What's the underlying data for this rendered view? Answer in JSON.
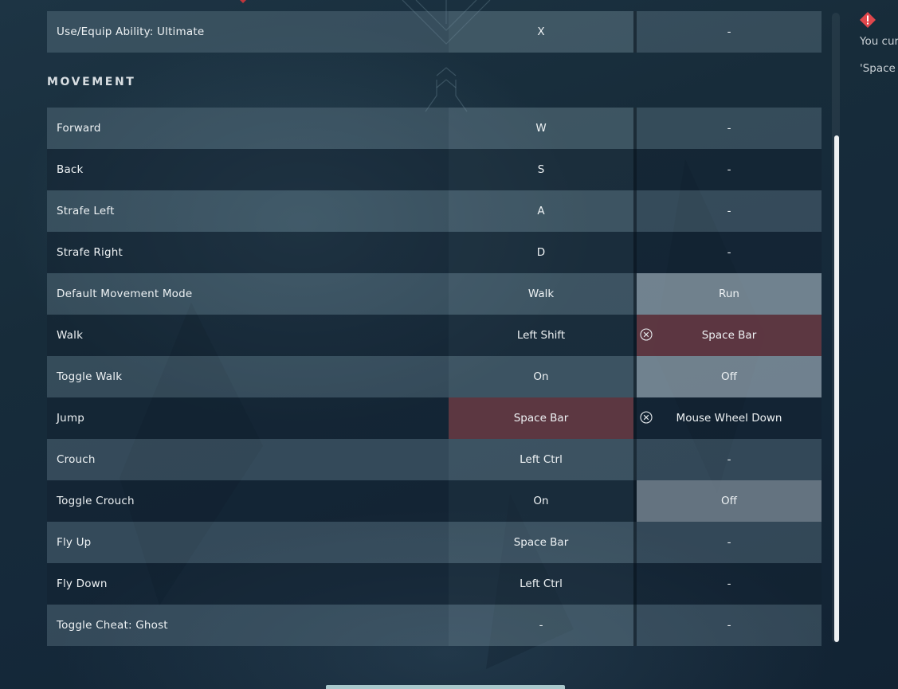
{
  "section": {
    "title": "MOVEMENT"
  },
  "rows": [
    {
      "action": "Use/Equip Ability: Ultimate",
      "primary": "X",
      "secondary": "-"
    },
    {
      "action": "Forward",
      "primary": "W",
      "secondary": "-"
    },
    {
      "action": "Back",
      "primary": "S",
      "secondary": "-"
    },
    {
      "action": "Strafe Left",
      "primary": "A",
      "secondary": "-"
    },
    {
      "action": "Strafe Right",
      "primary": "D",
      "secondary": "-"
    },
    {
      "action": "Default Movement Mode",
      "primary": "Walk",
      "secondary": "Run"
    },
    {
      "action": "Walk",
      "primary": "Left Shift",
      "secondary": "Space Bar"
    },
    {
      "action": "Toggle Walk",
      "primary": "On",
      "secondary": "Off"
    },
    {
      "action": "Jump",
      "primary": "Space Bar",
      "secondary": "Mouse Wheel Down"
    },
    {
      "action": "Crouch",
      "primary": "Left Ctrl",
      "secondary": "-"
    },
    {
      "action": "Toggle Crouch",
      "primary": "On",
      "secondary": "Off"
    },
    {
      "action": "Fly Up",
      "primary": "Space Bar",
      "secondary": "-"
    },
    {
      "action": "Fly Down",
      "primary": "Left Ctrl",
      "secondary": "-"
    },
    {
      "action": "Toggle Cheat: Ghost",
      "primary": "-",
      "secondary": "-"
    }
  ],
  "notice": {
    "line1": "You cur",
    "line2": "'Space",
    "icon": "warning-diamond-icon"
  },
  "colors": {
    "conflict": "#783e46",
    "highlight": "#96a5b0",
    "warning": "#e0474c"
  }
}
